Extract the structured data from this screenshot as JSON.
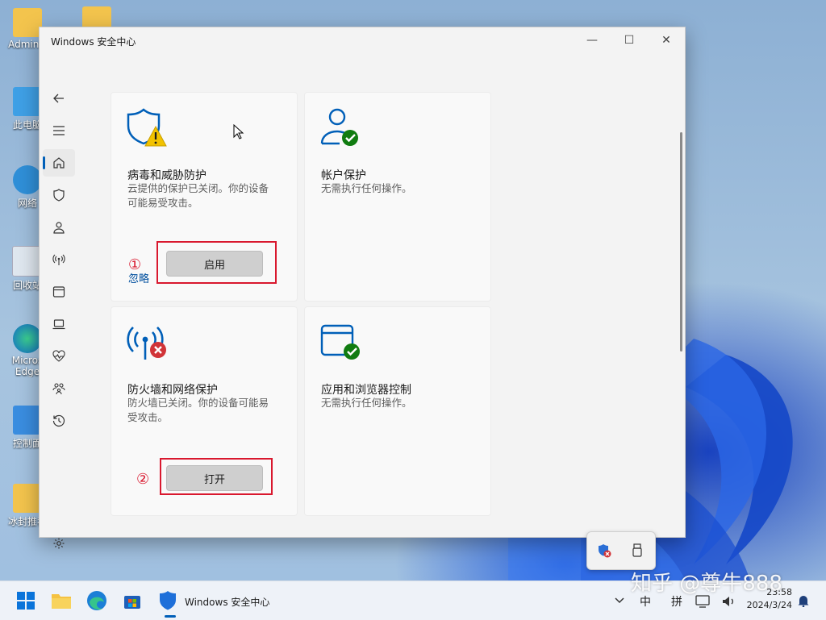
{
  "desktop": {
    "icons": [
      {
        "label": "Adminis"
      },
      {
        "label": "此电脑"
      },
      {
        "label": "网络"
      },
      {
        "label": "回收站"
      },
      {
        "label": "Micros Edge"
      },
      {
        "label": "控制面"
      },
      {
        "label": "冰封推荐"
      }
    ]
  },
  "window": {
    "title": "Windows 安全中心",
    "controls": {
      "minimize": "—",
      "maximize": "☐",
      "close": "✕"
    }
  },
  "nav": {
    "items": [
      {
        "icon": "back-arrow-icon"
      },
      {
        "icon": "hamburger-menu-icon"
      },
      {
        "icon": "home-icon"
      },
      {
        "icon": "shield-icon"
      },
      {
        "icon": "person-icon"
      },
      {
        "icon": "wireless-antenna-icon"
      },
      {
        "icon": "app-window-icon"
      },
      {
        "icon": "laptop-icon"
      },
      {
        "icon": "heart-pulse-icon"
      },
      {
        "icon": "family-icon"
      },
      {
        "icon": "history-icon"
      },
      {
        "icon": "settings-gear-icon"
      }
    ]
  },
  "cards": {
    "virus": {
      "title": "病毒和威胁防护",
      "desc_line1": "云提供的保护已关闭。你的设备",
      "desc_line2": "可能易受攻击。",
      "button": "启用",
      "link": "忽略",
      "annotation": "①"
    },
    "account": {
      "title": "帐户保护",
      "desc": "无需执行任何操作。"
    },
    "firewall": {
      "title": "防火墙和网络保护",
      "desc_line1": "防火墙已关闭。你的设备可能易",
      "desc_line2": "受攻击。",
      "button": "打开",
      "annotation": "②"
    },
    "appbrowser": {
      "title": "应用和浏览器控制",
      "desc": "无需执行任何操作。"
    }
  },
  "colors": {
    "accent": "#005fb8",
    "warning": "#f2c200",
    "ok": "#107c10",
    "error": "#d13438",
    "annotation_red": "#d9182e"
  },
  "taskbar": {
    "running_app_label": "Windows 安全中心",
    "ime": [
      "中",
      "拼"
    ],
    "clock_time": "23:58",
    "clock_date": "2024/3/24"
  },
  "watermark": "知乎 @尊牛888"
}
